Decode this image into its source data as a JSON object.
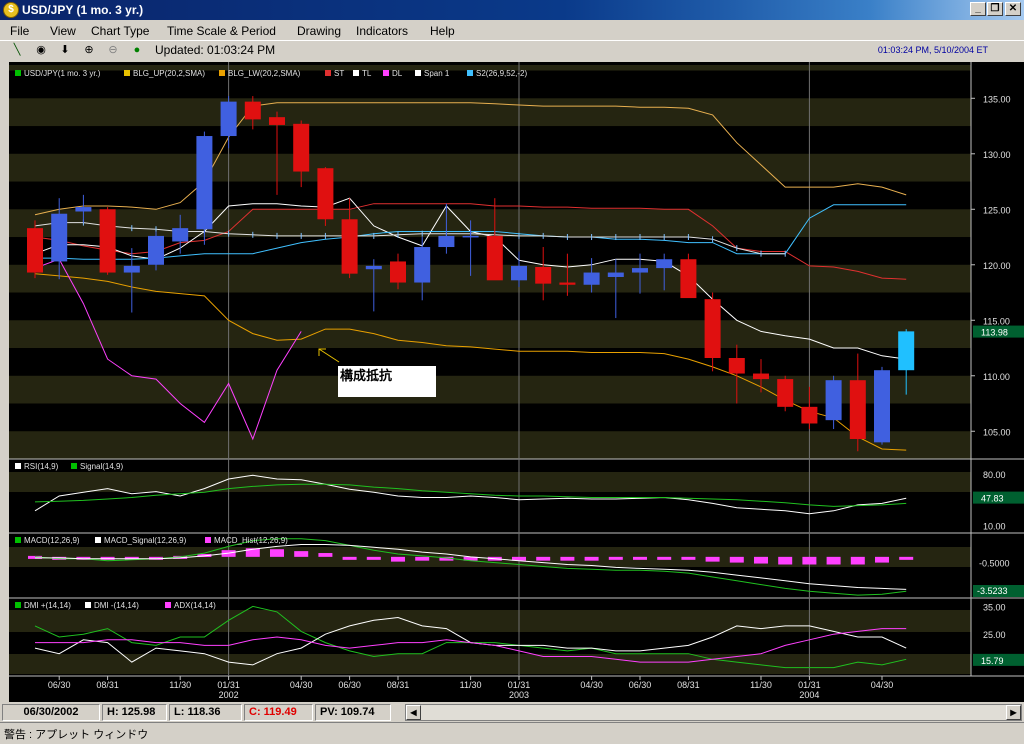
{
  "window": {
    "title": "USD/JPY (1 mo. 3 yr.)",
    "minimize": "_",
    "maximize": "❐",
    "close": "✕"
  },
  "menu": [
    "File",
    "View",
    "Chart Type",
    "Time Scale & Period",
    "Drawing",
    "Indicators",
    "Help"
  ],
  "toolbar": {
    "updated": "Updated: 01:03:24 PM",
    "datetime": "01:03:24 PM, 5/10/2004 ET"
  },
  "chart_data": [
    {
      "type": "candlestick",
      "legend": [
        "USD/JPY(1 mo. 3 yr.)",
        "BLG_UP(20,2,SMA)",
        "BLG_LW(20,2,SMA)",
        "ST",
        "TL",
        "DL",
        "Span 1",
        "S2(26,9,52,-2)"
      ],
      "legend_colors": [
        "#00c000",
        "#e8c000",
        "#e8a000",
        "#e03030",
        "#ffffff",
        "#ff40ff",
        "#ffffff",
        "#40c0ff"
      ],
      "y_ticks": [
        135.0,
        130.0,
        125.0,
        120.0,
        115.0,
        110.0,
        105.0
      ],
      "ylim": [
        102.5,
        138
      ],
      "last_value": "113.98",
      "annotation": "構成抵抗",
      "candles": [
        {
          "o": 123.3,
          "h": 124.0,
          "l": 118.8,
          "c": 119.3
        },
        {
          "o": 120.3,
          "h": 126.0,
          "l": 118.7,
          "c": 124.6
        },
        {
          "o": 124.8,
          "h": 126.3,
          "l": 123.8,
          "c": 125.2
        },
        {
          "o": 125.0,
          "h": 125.2,
          "l": 119.1,
          "c": 119.3
        },
        {
          "o": 119.3,
          "h": 121.5,
          "l": 115.7,
          "c": 119.9
        },
        {
          "o": 120.0,
          "h": 123.0,
          "l": 119.5,
          "c": 122.6
        },
        {
          "o": 122.1,
          "h": 124.5,
          "l": 121.0,
          "c": 123.3
        },
        {
          "o": 123.2,
          "h": 132.0,
          "l": 121.8,
          "c": 131.6
        },
        {
          "o": 131.6,
          "h": 135.2,
          "l": 130.5,
          "c": 134.7
        },
        {
          "o": 134.7,
          "h": 135.2,
          "l": 132.2,
          "c": 133.1
        },
        {
          "o": 133.3,
          "h": 133.8,
          "l": 126.3,
          "c": 132.6
        },
        {
          "o": 132.7,
          "h": 133.0,
          "l": 127.0,
          "c": 128.4
        },
        {
          "o": 128.7,
          "h": 128.8,
          "l": 123.5,
          "c": 124.1
        },
        {
          "o": 124.1,
          "h": 126.0,
          "l": 118.8,
          "c": 119.2
        },
        {
          "o": 119.6,
          "h": 120.5,
          "l": 115.8,
          "c": 119.9
        },
        {
          "o": 120.3,
          "h": 121.0,
          "l": 117.8,
          "c": 118.4
        },
        {
          "o": 118.4,
          "h": 122.5,
          "l": 116.8,
          "c": 121.6
        },
        {
          "o": 121.6,
          "h": 125.5,
          "l": 121.0,
          "c": 122.6
        },
        {
          "o": 122.6,
          "h": 124.0,
          "l": 119.0,
          "c": 122.6
        },
        {
          "o": 122.6,
          "h": 126.0,
          "l": 118.8,
          "c": 118.6
        },
        {
          "o": 118.6,
          "h": 121.2,
          "l": 118.0,
          "c": 119.9
        },
        {
          "o": 119.8,
          "h": 121.6,
          "l": 116.8,
          "c": 118.3
        },
        {
          "o": 118.4,
          "h": 121.0,
          "l": 117.2,
          "c": 118.2
        },
        {
          "o": 118.2,
          "h": 120.6,
          "l": 117.5,
          "c": 119.3
        },
        {
          "o": 118.9,
          "h": 120.5,
          "l": 115.2,
          "c": 119.3
        },
        {
          "o": 119.3,
          "h": 121.0,
          "l": 117.4,
          "c": 119.7
        },
        {
          "o": 119.7,
          "h": 121.0,
          "l": 117.7,
          "c": 120.5
        },
        {
          "o": 120.5,
          "h": 121.0,
          "l": 118.0,
          "c": 117.0
        },
        {
          "o": 116.9,
          "h": 117.5,
          "l": 110.4,
          "c": 111.6
        },
        {
          "o": 111.6,
          "h": 112.8,
          "l": 107.5,
          "c": 110.2
        },
        {
          "o": 110.2,
          "h": 111.5,
          "l": 108.5,
          "c": 109.7
        },
        {
          "o": 109.7,
          "h": 110.0,
          "l": 106.8,
          "c": 107.2
        },
        {
          "o": 107.2,
          "h": 109.0,
          "l": 105.2,
          "c": 105.7
        },
        {
          "o": 106.0,
          "h": 110.0,
          "l": 105.2,
          "c": 109.6
        },
        {
          "o": 109.6,
          "h": 112.0,
          "l": 103.2,
          "c": 104.3
        },
        {
          "o": 104.0,
          "h": 110.8,
          "l": 103.8,
          "c": 110.5
        },
        {
          "o": 110.5,
          "h": 114.2,
          "l": 108.3,
          "c": 114.0
        }
      ],
      "bb_up": [
        124.5,
        125.0,
        125.3,
        125.3,
        125.2,
        125.0,
        125.6,
        127.5,
        131.5,
        134.3,
        134.6,
        134.6,
        134.6,
        134.6,
        134.6,
        134.6,
        134.6,
        134.6,
        134.6,
        134.5,
        134.4,
        134.3,
        134.3,
        134.3,
        134.3,
        134.2,
        134.2,
        134.1,
        133.5,
        131.0,
        129.0,
        127.0,
        127.0,
        127.0,
        127.3,
        127.0,
        126.3
      ],
      "bb_lw": [
        119.2,
        119.0,
        118.8,
        118.5,
        118.0,
        117.6,
        117.4,
        117.2,
        115.0,
        113.8,
        113.2,
        113.3,
        114.2,
        114.2,
        113.8,
        113.2,
        113.0,
        112.7,
        112.6,
        112.4,
        112.2,
        112.2,
        112.2,
        112.1,
        112.1,
        112.1,
        112.0,
        111.5,
        110.8,
        110.0,
        109.0,
        107.8,
        106.8,
        106.2,
        104.5,
        103.4,
        103.3
      ],
      "st": [
        122.5,
        122.2,
        121.7,
        121.3,
        121.0,
        121.2,
        122.0,
        122.2,
        123.0,
        125.0,
        125.0,
        125.0,
        125.0,
        125.0,
        125.5,
        125.5,
        125.5,
        125.5,
        125.5,
        125.3,
        125.3,
        125.2,
        125.2,
        125.1,
        125.1,
        125.1,
        125.0,
        125.0,
        123.5,
        121.5,
        121.2,
        121.2,
        119.9,
        119.8,
        119.4,
        118.8,
        118.7
      ],
      "tl": [
        121.0,
        121.8,
        121.8,
        121.6,
        120.8,
        120.5,
        121.5,
        123.0,
        125.3,
        125.5,
        125.5,
        125.3,
        125.2,
        126.0,
        123.5,
        122.5,
        121.7,
        125.3,
        123.0,
        122.5,
        120.4,
        120.0,
        119.8,
        120.0,
        120.5,
        120.5,
        120.3,
        119.0,
        116.9,
        115.0,
        114.0,
        113.6,
        113.3,
        112.5,
        112.5,
        111.8,
        111.5
      ],
      "span1": [
        123.5,
        123.8,
        123.8,
        123.5,
        123.3,
        123.2,
        123.0,
        123.0,
        122.8,
        122.7,
        122.6,
        122.6,
        122.6,
        122.6,
        122.6,
        122.7,
        122.8,
        122.8,
        122.8,
        122.7,
        122.6,
        122.6,
        122.5,
        122.5,
        122.5,
        122.5,
        122.5,
        122.5,
        122.3,
        121.5,
        121.0,
        121.0
      ],
      "span2": [
        120.6,
        120.6,
        120.5,
        120.5,
        120.5,
        120.6,
        120.8,
        121.0,
        121.0,
        121.0,
        121.5,
        122.0,
        122.3,
        122.5,
        122.8,
        123.0,
        123.0,
        123.0,
        123.0,
        123.0,
        122.8,
        122.6,
        122.5,
        122.5,
        122.3,
        122.3,
        122.2,
        122.0,
        122.0,
        121.0,
        121.0,
        121.0,
        124.2,
        125.4,
        125.4,
        125.4,
        125.4
      ],
      "dl": [
        119.7,
        120.5,
        116.5,
        111.5,
        110.0,
        109.7,
        107.5,
        105.8,
        109.3,
        104.3,
        110.5,
        114.0
      ]
    },
    {
      "type": "line",
      "legend": [
        "RSI(14,9)",
        "Signal(14,9)"
      ],
      "y_ticks": [
        80.0,
        10.0
      ],
      "ylim": [
        0,
        100
      ],
      "last_value": "47.83",
      "rsi": [
        30,
        50,
        55,
        60,
        53,
        56,
        50,
        60,
        73,
        78,
        73,
        72,
        66,
        59,
        55,
        50,
        48,
        48,
        50,
        48,
        45,
        46,
        47,
        46,
        46,
        47,
        48,
        45,
        40,
        34,
        32,
        30,
        26,
        30,
        38,
        40,
        47
      ],
      "signal": [
        42,
        43,
        44,
        46,
        48,
        51,
        53,
        55,
        60,
        63,
        65,
        66,
        66,
        65,
        62,
        60,
        57,
        55,
        53,
        51,
        50,
        50,
        49,
        48,
        48,
        48,
        48,
        47,
        46,
        45,
        43,
        41,
        38,
        36,
        37,
        38,
        40
      ]
    },
    {
      "type": "line",
      "legend": [
        "MACD(12,26,9)",
        "MACD_Signal(12,26,9)",
        "MACD_Hist(12,26,9)"
      ],
      "y_ticks": [
        "-0.5000"
      ],
      "last_value": "-3.5233",
      "ylim": [
        -4.2,
        2.6
      ],
      "macd": [
        0.1,
        -0.1,
        -0.1,
        -0.3,
        -0.2,
        -0.1,
        0.1,
        0.5,
        1.2,
        1.8,
        2.0,
        2.0,
        1.8,
        1.3,
        0.8,
        0.4,
        0.2,
        0.0,
        -0.3,
        -0.5,
        -0.7,
        -0.9,
        -1.1,
        -1.2,
        -1.3,
        -1.3,
        -1.4,
        -1.6,
        -2.0,
        -2.4,
        -2.8,
        -3.2,
        -3.5,
        -3.7,
        -3.9,
        -3.8,
        -3.5
      ],
      "signal": [
        0.0,
        0.0,
        -0.1,
        -0.1,
        -0.1,
        -0.1,
        0.0,
        0.2,
        0.5,
        0.9,
        1.2,
        1.4,
        1.4,
        1.3,
        1.1,
        0.9,
        0.6,
        0.4,
        0.1,
        -0.1,
        -0.3,
        -0.5,
        -0.7,
        -0.8,
        -1.0,
        -1.1,
        -1.2,
        -1.3,
        -1.5,
        -1.8,
        -2.1,
        -2.4,
        -2.7,
        -2.9,
        -3.1,
        -3.2,
        -3.3
      ],
      "hist": [
        0.1,
        -0.1,
        0.0,
        -0.2,
        -0.1,
        0.0,
        0.1,
        0.3,
        0.7,
        0.9,
        0.8,
        0.6,
        0.4,
        0.0,
        -0.3,
        -0.5,
        -0.4,
        -0.4,
        -0.4,
        -0.4,
        -0.4,
        -0.4,
        -0.4,
        -0.4,
        -0.3,
        -0.2,
        -0.2,
        -0.3,
        -0.5,
        -0.6,
        -0.7,
        -0.8,
        -0.8,
        -0.8,
        -0.8,
        -0.6,
        -0.2
      ]
    },
    {
      "type": "line",
      "legend": [
        "DMI +(14,14)",
        "DMI -(14,14)",
        "ADX(14,14)"
      ],
      "y_ticks": [
        35.0,
        25.0
      ],
      "ylim": [
        10,
        38
      ],
      "last_value": "15.79",
      "dmi_plus": [
        28,
        24,
        25,
        27,
        22,
        21,
        24,
        24,
        30,
        35,
        33,
        26,
        22,
        19,
        17,
        18,
        18,
        22,
        22,
        22,
        21,
        20,
        19,
        20,
        18,
        18,
        18,
        18,
        16,
        15,
        14,
        13,
        13,
        13,
        15,
        14,
        16
      ],
      "dmi_minus": [
        20,
        18,
        23,
        22,
        15,
        20,
        19,
        18,
        15,
        14,
        18,
        20,
        25,
        28,
        30,
        31,
        28,
        27,
        22,
        21,
        21,
        21,
        20,
        20,
        19,
        19,
        20,
        21,
        24,
        28,
        27,
        28,
        28,
        26,
        24,
        24,
        20
      ],
      "adx": [
        22,
        22,
        22,
        23,
        23,
        22,
        22,
        21,
        21,
        23,
        24,
        23,
        21,
        20,
        21,
        22,
        22,
        23,
        22,
        21,
        19,
        17,
        17,
        17,
        16,
        15,
        15,
        15,
        16,
        17,
        18,
        21,
        23,
        25,
        26,
        27,
        27
      ]
    }
  ],
  "x_axis": [
    {
      "label": "06/30",
      "i": 1
    },
    {
      "label": "08/31",
      "i": 3
    },
    {
      "label": "11/30",
      "i": 6
    },
    {
      "label": "01/31",
      "i": 8,
      "year": "2002"
    },
    {
      "label": "04/30",
      "i": 11
    },
    {
      "label": "06/30",
      "i": 13
    },
    {
      "label": "08/31",
      "i": 15
    },
    {
      "label": "11/30",
      "i": 18
    },
    {
      "label": "01/31",
      "i": 20,
      "year": "2003"
    },
    {
      "label": "04/30",
      "i": 23
    },
    {
      "label": "06/30",
      "i": 25
    },
    {
      "label": "08/31",
      "i": 27
    },
    {
      "label": "11/30",
      "i": 30
    },
    {
      "label": "01/31",
      "i": 32,
      "year": "2004"
    },
    {
      "label": "04/30",
      "i": 35
    }
  ],
  "status": {
    "date": "06/30/2002",
    "high": "H: 125.98",
    "low": "L: 118.36",
    "close": "C: 119.49",
    "pv": "PV: 109.74"
  },
  "warning": "警告 : アプレット ウィンドウ"
}
